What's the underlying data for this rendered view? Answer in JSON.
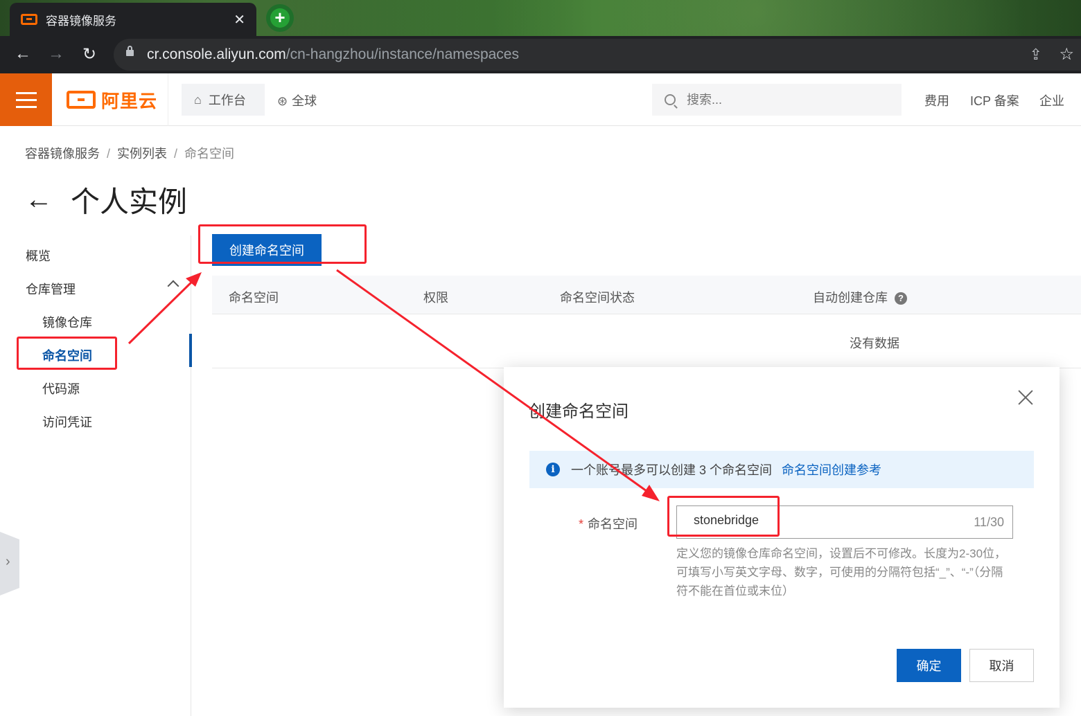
{
  "browser": {
    "tab_title": "容器镜像服务",
    "tab_close": "✕",
    "new_tab": "+",
    "back": "←",
    "forward": "→",
    "reload": "↻",
    "url_host": "cr.console.aliyun.com",
    "url_path": "/cn-hangzhou/instance/namespaces",
    "share": "⇪",
    "bookmark": "☆"
  },
  "topbar": {
    "brand": "阿里云",
    "workbench": "工作台",
    "home_icon": "⌂",
    "global": "全球",
    "globe_icon": "⊛",
    "search_placeholder": "搜索...",
    "links": [
      "费用",
      "ICP 备案",
      "企业"
    ]
  },
  "breadcrumb": {
    "items": [
      "容器镜像服务",
      "实例列表",
      "命名空间"
    ],
    "sep": "/"
  },
  "page": {
    "back_arrow": "←",
    "title": "个人实例"
  },
  "sidenav": {
    "overview": "概览",
    "repo_management": "仓库管理",
    "image_repos": "镜像仓库",
    "namespaces": "命名空间",
    "code_sources": "代码源",
    "access_credentials": "访问凭证",
    "collapse": "›"
  },
  "main": {
    "create_button": "创建命名空间",
    "columns": [
      "命名空间",
      "权限",
      "命名空间状态",
      "自动创建仓库"
    ],
    "help": "?",
    "empty": "没有数据"
  },
  "modal": {
    "title": "创建命名空间",
    "notice_text": "一个账号最多可以创建 3 个命名空间",
    "notice_link": "命名空间创建参考",
    "info": "i",
    "required_mark": "*",
    "field_label": "命名空间",
    "field_value": "stonebridge",
    "counter": "11/30",
    "hint": "定义您的镜像仓库命名空间，设置后不可修改。长度为2-30位，可填写小写英文字母、数字，可使用的分隔符包括“_”、“-”（分隔符不能在首位或末位）",
    "ok": "确定",
    "cancel": "取消"
  },
  "colors": {
    "accent": "#0b63c1",
    "brand": "#ff6a00",
    "annotation": "#f5222d"
  }
}
